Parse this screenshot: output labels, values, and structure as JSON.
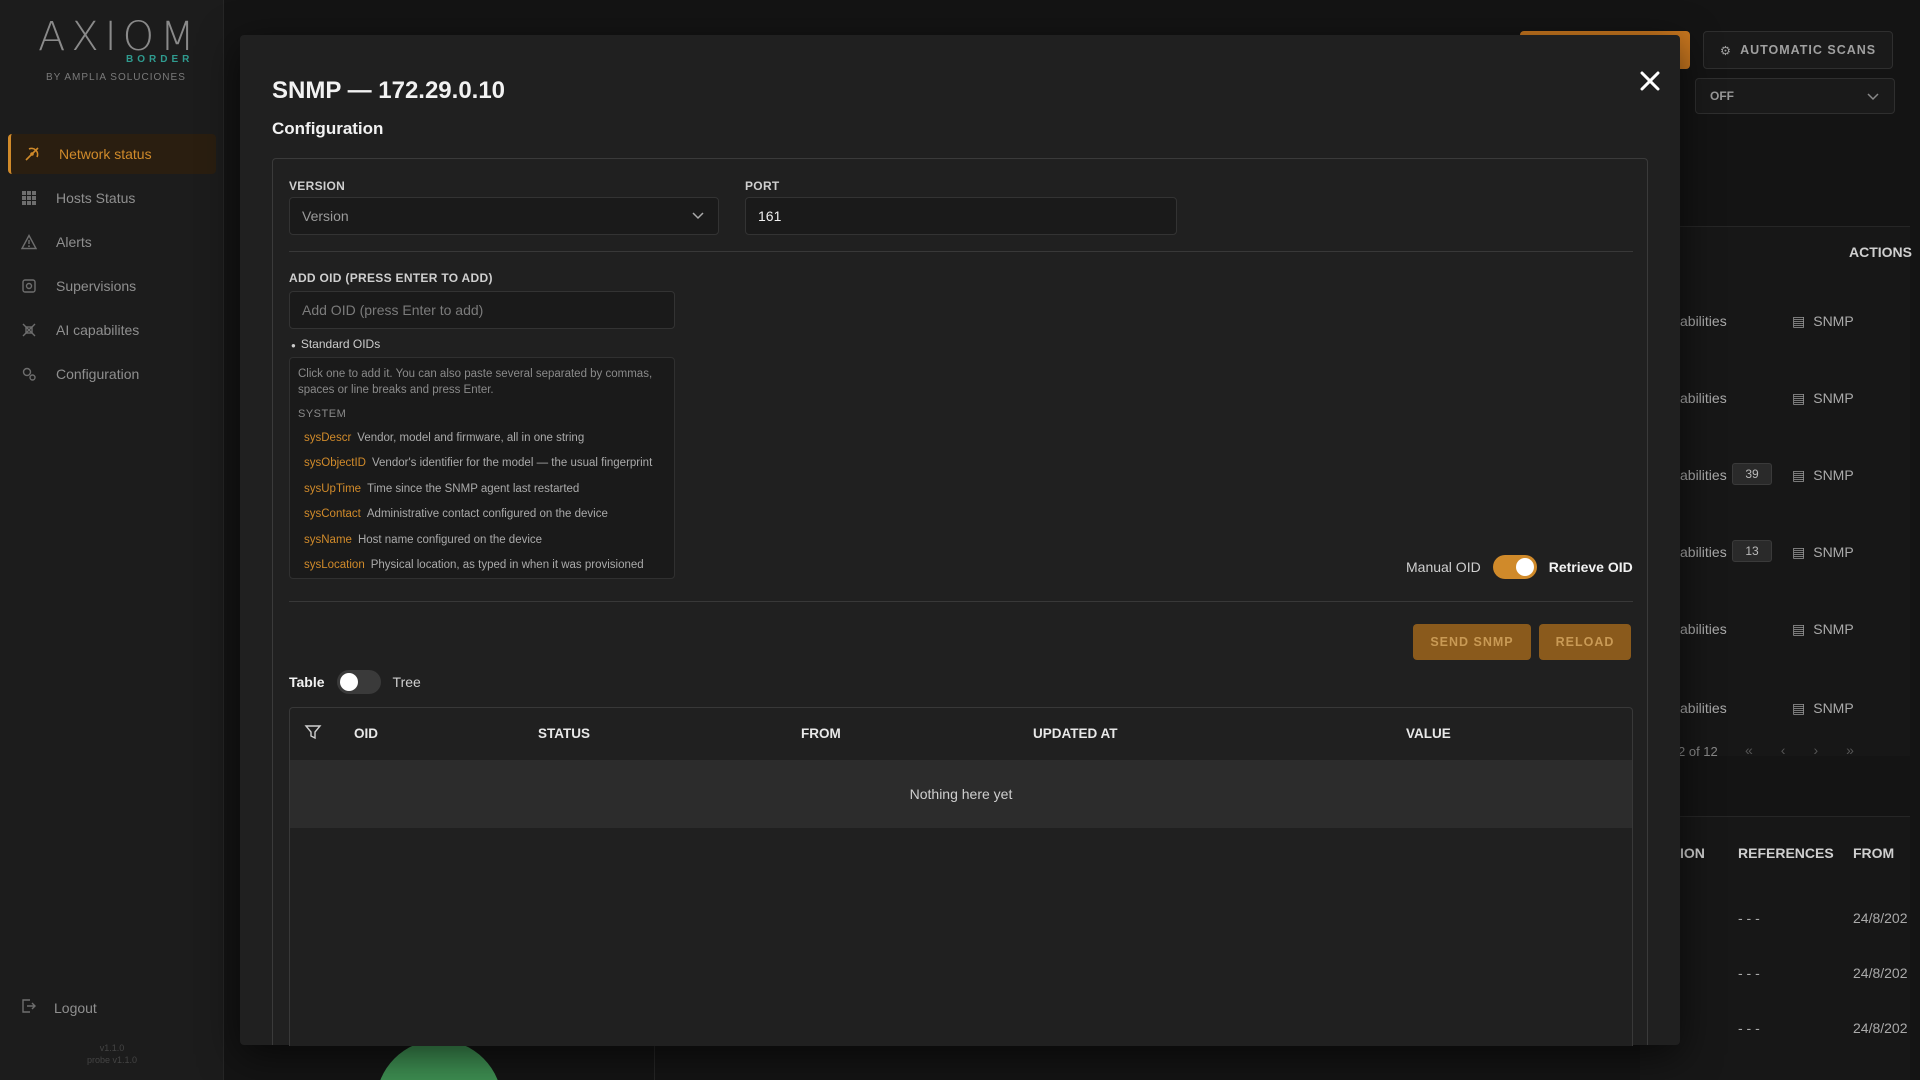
{
  "sidebar": {
    "logo_text": "AXIOM",
    "logo_sub": "BORDER",
    "logo_by": "BY AMPLIA SOLUCIONES",
    "items": [
      {
        "label": "Network status",
        "icon": "network-icon"
      },
      {
        "label": "Hosts Status",
        "icon": "grid-icon"
      },
      {
        "label": "Alerts",
        "icon": "warning-icon"
      },
      {
        "label": "Supervisions",
        "icon": "supervision-icon"
      },
      {
        "label": "AI capabilites",
        "icon": "ai-icon"
      },
      {
        "label": "Configuration",
        "icon": "gear-icon"
      }
    ],
    "logout_label": "Logout",
    "version_line1": "v1.1.0",
    "version_line2": "probe v1.1.0"
  },
  "background": {
    "scans_label": "AUTOMATIC SCANS",
    "off_value": "OFF",
    "actions_header": "ACTIONS",
    "rows": [
      {
        "cap": "abilities",
        "count": "",
        "action": "SNMP"
      },
      {
        "cap": "abilities",
        "count": "",
        "action": "SNMP"
      },
      {
        "cap": "abilities",
        "count": "39",
        "action": "SNMP"
      },
      {
        "cap": "abilities",
        "count": "13",
        "action": "SNMP"
      },
      {
        "cap": "abilities",
        "count": "",
        "action": "SNMP"
      },
      {
        "cap": "abilities",
        "count": "",
        "action": "SNMP"
      }
    ],
    "pagination": "2 of 12",
    "headers2": [
      "ION",
      "REFERENCES",
      "FROM"
    ],
    "rows2": [
      {
        "ref": "- - -",
        "from": "24/8/202"
      },
      {
        "ref": "- - -",
        "from": "24/8/202"
      },
      {
        "ref": "- - -",
        "from": "24/8/202"
      }
    ]
  },
  "modal": {
    "title": "SNMP — 172.29.0.10",
    "subtitle": "Configuration",
    "version_label": "VERSION",
    "version_placeholder": "Version",
    "port_label": "PORT",
    "port_value": "161",
    "add_oid_label": "ADD OID (PRESS ENTER TO ADD)",
    "add_oid_placeholder": "Add OID (press Enter to add)",
    "standard_oids_label": "Standard OIDs",
    "standard_help": "Click one to add it. You can also paste several separated by commas, spaces or line breaks and press Enter.",
    "standard_group": "SYSTEM",
    "standard_oids": [
      {
        "name": "sysDescr",
        "desc": "Vendor, model and firmware, all in one string"
      },
      {
        "name": "sysObjectID",
        "desc": "Vendor's identifier for the model — the usual fingerprint"
      },
      {
        "name": "sysUpTime",
        "desc": "Time since the SNMP agent last restarted"
      },
      {
        "name": "sysContact",
        "desc": "Administrative contact configured on the device"
      },
      {
        "name": "sysName",
        "desc": "Host name configured on the device"
      },
      {
        "name": "sysLocation",
        "desc": "Physical location, as typed in when it was provisioned"
      }
    ],
    "manual_oid_label": "Manual OID",
    "retrieve_oid_label": "Retrieve OID",
    "send_button": "SEND SNMP",
    "reload_button": "RELOAD",
    "table_label": "Table",
    "tree_label": "Tree",
    "columns": [
      "OID",
      "STATUS",
      "FROM",
      "UPDATED AT",
      "VALUE"
    ],
    "empty_text": "Nothing here yet"
  },
  "colors": {
    "accent": "#d08a2a",
    "button_bg": "#8a5a1c",
    "modal_bg": "#202020"
  }
}
